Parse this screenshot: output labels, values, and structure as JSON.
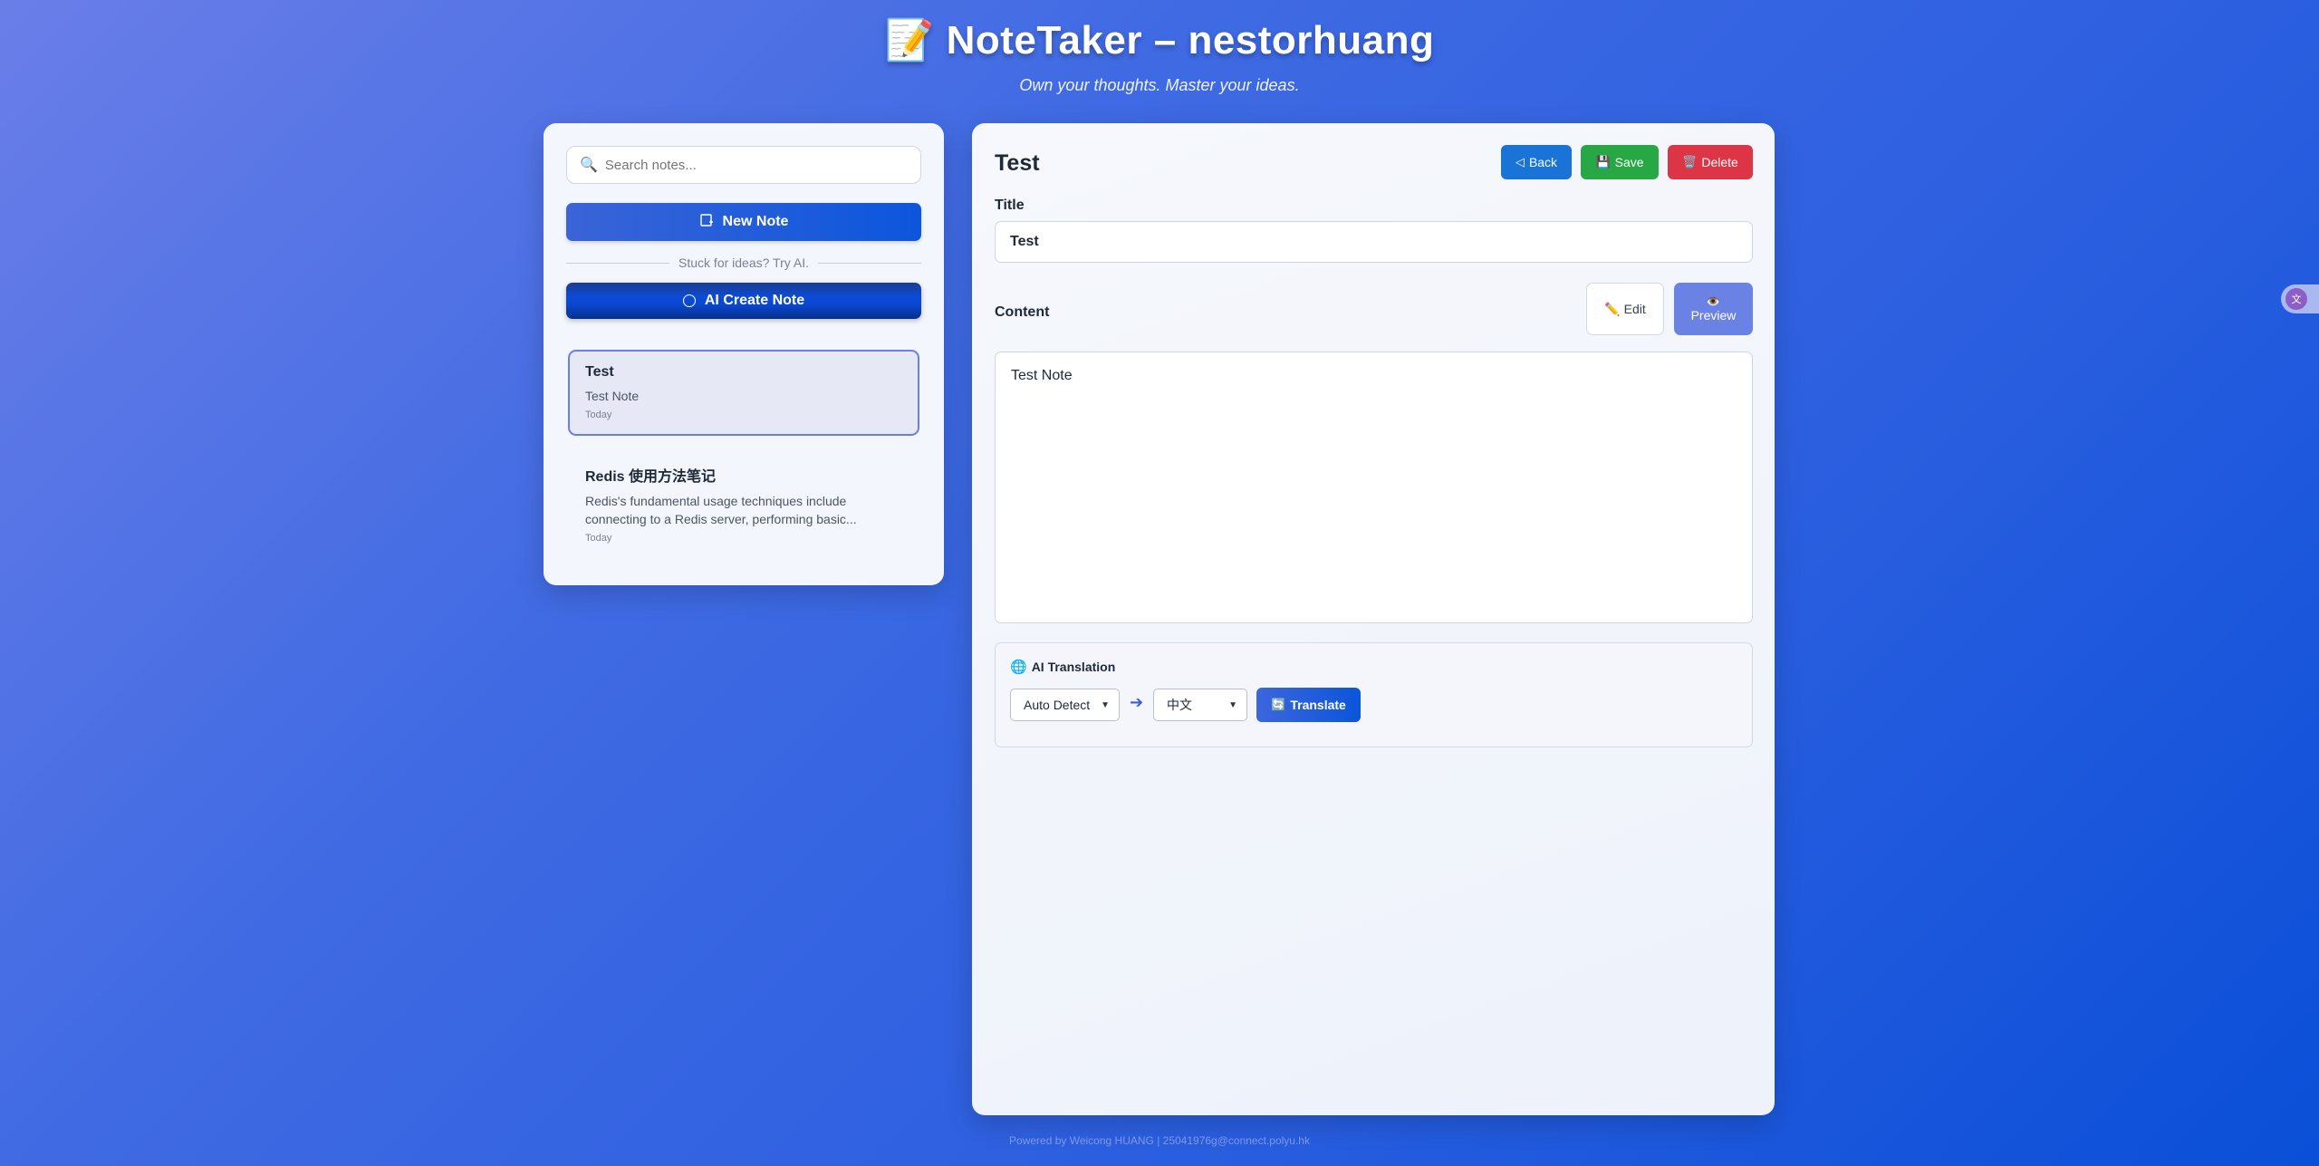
{
  "header": {
    "title": "📝 NoteTaker – nestorhuang",
    "subtitle": "Own your thoughts. Master your ideas."
  },
  "sidebar": {
    "search": {
      "placeholder": "Search notes...",
      "icon": "🔍"
    },
    "new_note_label": "New Note",
    "divider_text": "Stuck for ideas? Try AI.",
    "ai_create_label": "AI Create Note",
    "notes": [
      {
        "title": "Test",
        "excerpt": "Test Note",
        "date": "Today",
        "active": true
      },
      {
        "title": "Redis 使用方法笔记",
        "excerpt": "Redis's fundamental usage techniques include connecting to a Redis server, performing basic...",
        "date": "Today",
        "active": false
      }
    ]
  },
  "editor": {
    "note_title": "Test",
    "back_label": "Back",
    "save_label": "Save",
    "delete_label": "Delete",
    "title_label": "Title",
    "title_value": "Test",
    "content_label": "Content",
    "edit_label": "Edit",
    "preview_label": "Preview",
    "content_value": "Test Note",
    "translation": {
      "heading": "AI Translation",
      "from_value": "Auto Detect",
      "to_value": "中文",
      "translate_label": "Translate"
    }
  },
  "footer": {
    "text": "Powered by Weicong HUANG | 25041976g@connect.polyu.hk"
  },
  "colors": {
    "back": "#1a73d6",
    "save": "#28a745",
    "delete": "#dc3545",
    "preview": "#6a82e4"
  }
}
